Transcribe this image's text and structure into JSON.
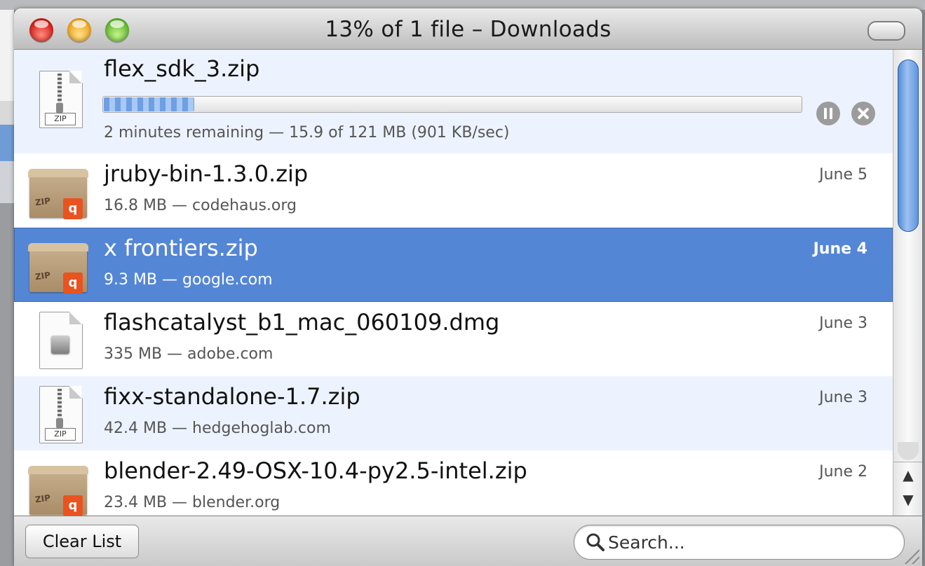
{
  "window": {
    "title": "13% of 1 file – Downloads"
  },
  "downloads": [
    {
      "name": "flex_sdk_3.zip",
      "status": "2 minutes remaining — 15.9 of 121 MB (901 KB/sec)",
      "progress_percent": 13,
      "icon": "zip-file-icon",
      "zip_label": "ZIP"
    },
    {
      "name": "jruby-bin-1.3.0.zip",
      "meta": "16.8 MB — codehaus.org",
      "date": "June 5",
      "icon": "archive-box-icon"
    },
    {
      "name": "x frontiers.zip",
      "meta": "9.3 MB — google.com",
      "date": "June 4",
      "icon": "archive-box-icon",
      "selected": true
    },
    {
      "name": "flashcatalyst_b1_mac_060109.dmg",
      "meta": "335 MB — adobe.com",
      "date": "June 3",
      "icon": "disk-image-icon"
    },
    {
      "name": "fixx-standalone-1.7.zip",
      "meta": "42.4 MB — hedgehoglab.com",
      "date": "June 3",
      "icon": "zip-file-icon",
      "zip_label": "ZIP"
    },
    {
      "name": "blender-2.49-OSX-10.4-py2.5-intel.zip",
      "meta": "23.4 MB — blender.org",
      "date": "June 2",
      "icon": "archive-box-icon"
    }
  ],
  "scrollbar": {
    "up_arrow": "▲",
    "down_arrow": "▼"
  },
  "footer": {
    "clear_label": "Clear List",
    "search_placeholder": "Search..."
  },
  "colors": {
    "selection": "#5486d6",
    "alternate_row": "#edf3fe",
    "progress": "#6e9fe4"
  }
}
